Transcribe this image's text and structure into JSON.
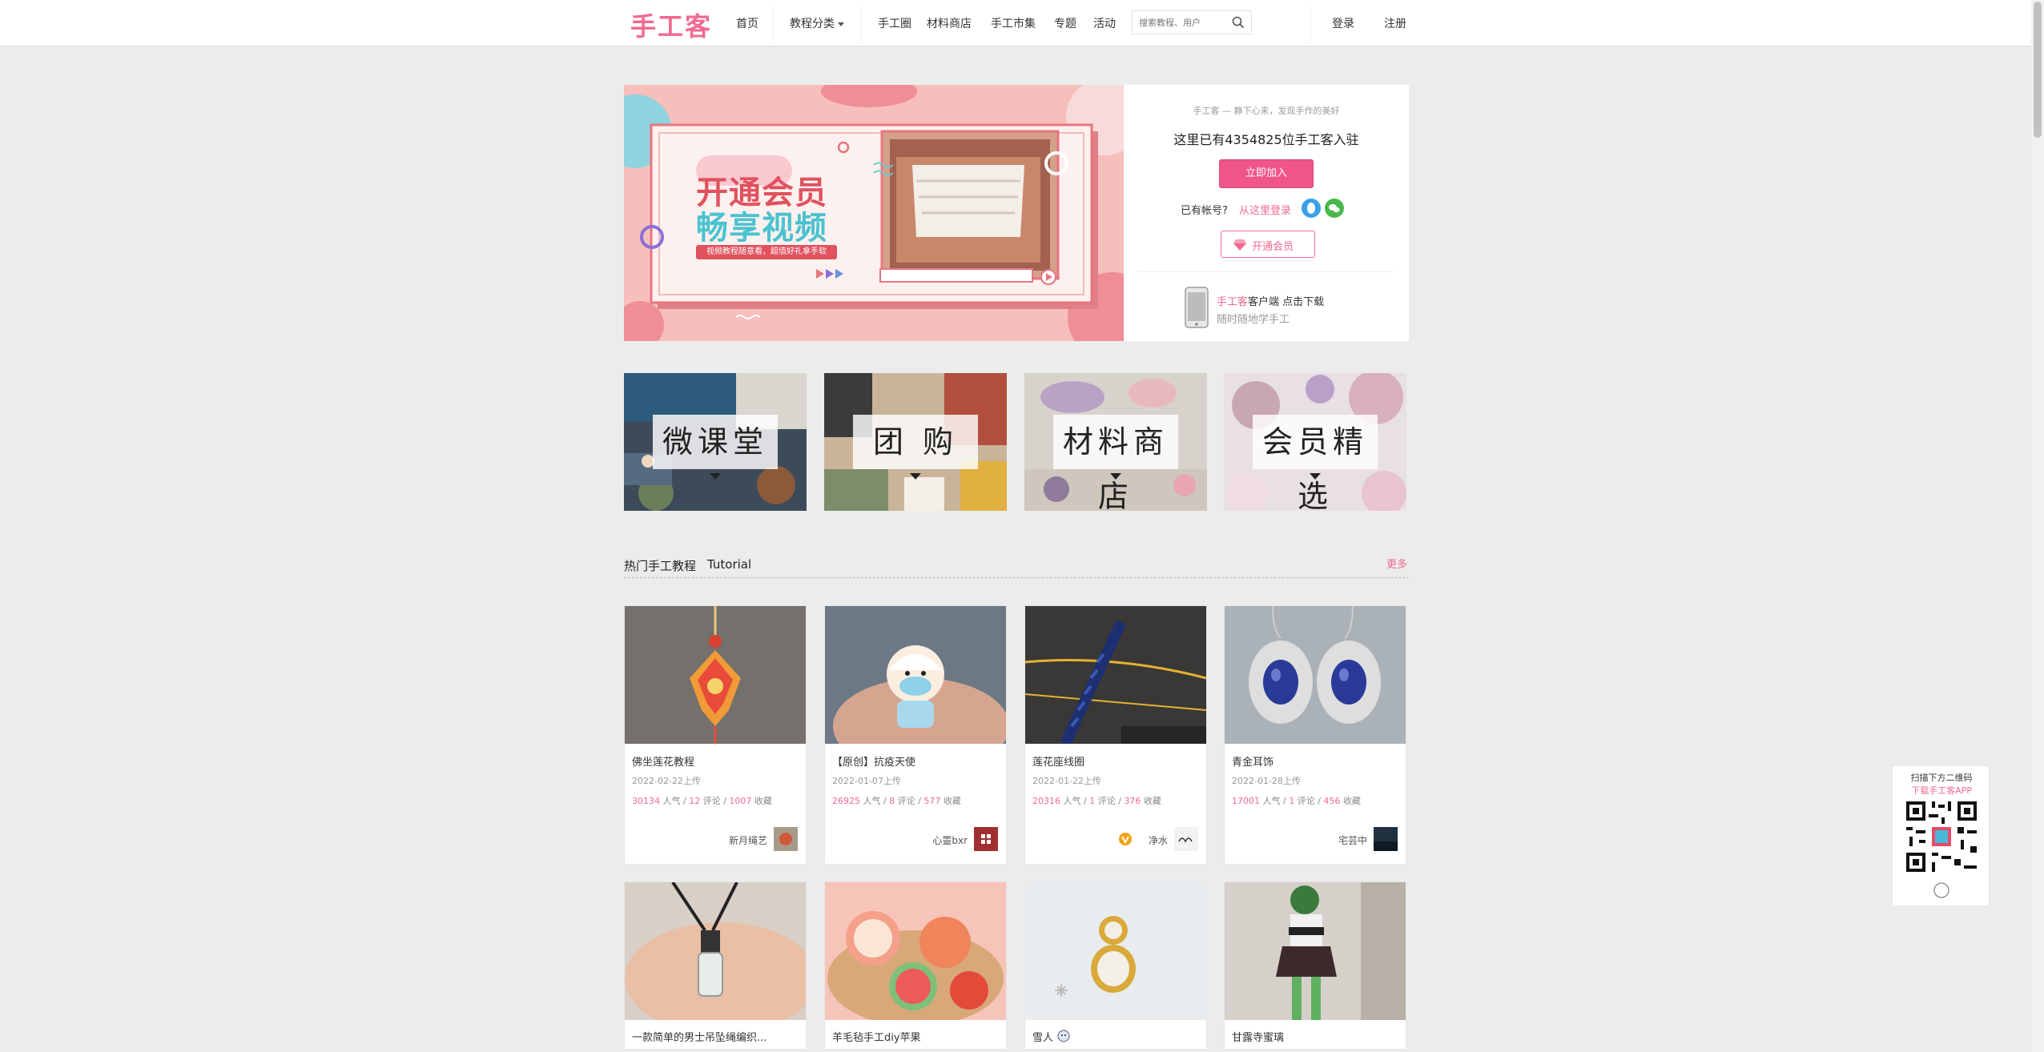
{
  "header": {
    "logo": "手工客",
    "nav": {
      "home": "首页",
      "categories": "教程分类",
      "circle": "手工圈",
      "material_shop": "材料商店",
      "market": "手工市集",
      "topics": "专题",
      "events": "活动"
    },
    "search": {
      "placeholder": "搜索教程、用户"
    },
    "login": "登录",
    "register": "注册"
  },
  "banner": {
    "line1": "开通会员",
    "line2": "畅享视频",
    "sub": "视频教程随意看，超值好礼拿手软"
  },
  "side": {
    "slogan": "手工客 — 静下心来，发现手作的美好",
    "count_text": "这里已有4354825位手工客入驻",
    "join_button": "立即加入",
    "has_account": "已有帐号?",
    "login_here": "从这里登录",
    "vip_button": "开通会员",
    "app_brand": "手工客",
    "app_line1_rest": "客户端 点击下载",
    "app_line2": "随时随地学手工"
  },
  "categories": [
    {
      "label": "微课堂"
    },
    {
      "label": "团 购"
    },
    {
      "label": "材料商店"
    },
    {
      "label": "会员精选"
    }
  ],
  "section": {
    "title": "热门手工教程",
    "title_en": "Tutorial",
    "more": "更多"
  },
  "tutorials": [
    {
      "title": "佛坐莲花教程",
      "date": "2022-02-22上传",
      "popularity": "30134",
      "popularity_label": "人气",
      "comments": "12",
      "comments_label": "评论",
      "favorites": "1007",
      "favorites_label": "收藏",
      "author": "新月绳艺"
    },
    {
      "title": "【原创】抗疫天使",
      "date": "2022-01-07上传",
      "popularity": "26925",
      "popularity_label": "人气",
      "comments": "8",
      "comments_label": "评论",
      "favorites": "577",
      "favorites_label": "收藏",
      "author": "心靈bxr"
    },
    {
      "title": "莲花座线圈",
      "date": "2022-01-22上传",
      "popularity": "20316",
      "popularity_label": "人气",
      "comments": "1",
      "comments_label": "评论",
      "favorites": "376",
      "favorites_label": "收藏",
      "author": "净水"
    },
    {
      "title": "青金耳饰",
      "date": "2022-01-28上传",
      "popularity": "17001",
      "popularity_label": "人气",
      "comments": "1",
      "comments_label": "评论",
      "favorites": "456",
      "favorites_label": "收藏",
      "author": "宅芸中"
    }
  ],
  "tutorials_row2": [
    {
      "title": "一款简单的男士吊坠绳编织..."
    },
    {
      "title": "羊毛毡手工diy苹果"
    },
    {
      "title": "雪人"
    },
    {
      "title": "甘露寺蜜璃"
    }
  ],
  "qr": {
    "line1": "扫描下方二维码",
    "line2": "下载手工客APP"
  },
  "colors": {
    "brand": "#f06a8f",
    "join_bg": "#f0558a"
  }
}
